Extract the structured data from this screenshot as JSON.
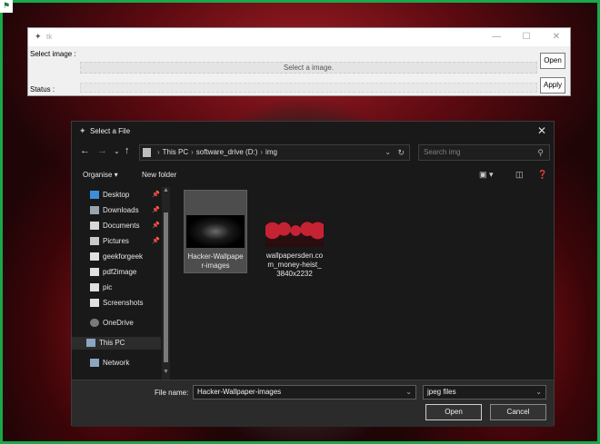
{
  "corner_logo": "⚑",
  "tk": {
    "title": "tk",
    "select_label": "Select image :",
    "entry_text": "Select a image.",
    "status_label": "Status :",
    "open_button": "Open",
    "apply_button": "Apply",
    "minimize_glyph": "—",
    "maximize_glyph": "☐",
    "close_glyph": "✕"
  },
  "dialog": {
    "title": "Select a File",
    "close_glyph": "✕",
    "breadcrumb": [
      "This PC",
      "software_drive (D:)",
      "img"
    ],
    "search_placeholder": "Search img",
    "toolbar": {
      "organise": "Organise ▾",
      "new_folder": "New folder"
    },
    "nav_items": [
      {
        "label": "Desktop",
        "icon": "desktop-icon",
        "pinned": true
      },
      {
        "label": "Downloads",
        "icon": "downloads-icon",
        "pinned": true
      },
      {
        "label": "Documents",
        "icon": "documents-icon",
        "pinned": true
      },
      {
        "label": "Pictures",
        "icon": "pictures-icon",
        "pinned": true
      },
      {
        "label": "geekforgeek",
        "icon": "folder-icon",
        "pinned": false
      },
      {
        "label": "pdf2image",
        "icon": "folder-icon",
        "pinned": false
      },
      {
        "label": "pic",
        "icon": "folder-icon",
        "pinned": false
      },
      {
        "label": "Screenshots",
        "icon": "folder-icon",
        "pinned": false
      },
      {
        "label": "OneDrive",
        "icon": "onedrive-icon",
        "pinned": false
      },
      {
        "label": "This PC",
        "icon": "this-pc-icon",
        "pinned": false,
        "selected": true
      },
      {
        "label": "Network",
        "icon": "network-icon",
        "pinned": false
      }
    ],
    "files": [
      {
        "name_line1": "Hacker-Wallpape",
        "name_line2": "r-images",
        "selected": true
      },
      {
        "name_line1": "wallpapersden.co",
        "name_line2": "m_money-heist_",
        "name_line3": "3840x2232",
        "selected": false
      }
    ],
    "filename_label": "File name:",
    "filename_value": "Hacker-Wallpaper-images",
    "filetype_value": "jpeg files",
    "open_button": "Open",
    "cancel_button": "Cancel"
  },
  "colors": {
    "frame": "#19a84a",
    "dialog_bg": "#191919",
    "tk_bg": "#f0f0f0"
  }
}
